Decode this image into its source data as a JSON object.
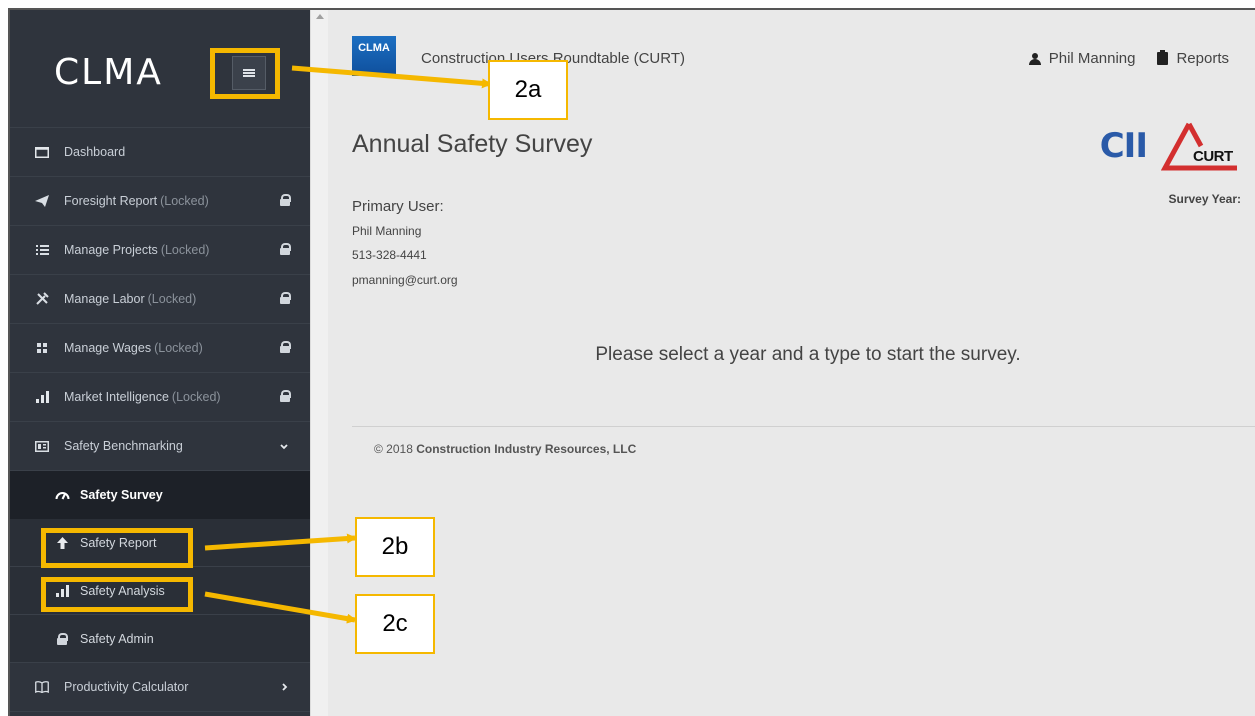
{
  "sidebar": {
    "logo": "CLMA",
    "items": [
      {
        "label": "Dashboard",
        "suffix": "",
        "icon": "monitor-icon"
      },
      {
        "label": "Foresight Report",
        "suffix": "(Locked)",
        "icon": "paper-plane-icon"
      },
      {
        "label": "Manage Projects",
        "suffix": "(Locked)",
        "icon": "list-icon"
      },
      {
        "label": "Manage Labor",
        "suffix": "(Locked)",
        "icon": "tools-icon"
      },
      {
        "label": "Manage Wages",
        "suffix": "(Locked)",
        "icon": "grid-icon"
      },
      {
        "label": "Market Intelligence",
        "suffix": "(Locked)",
        "icon": "bar-chart-icon"
      },
      {
        "label": "Safety Benchmarking",
        "suffix": "",
        "icon": "newspaper-icon"
      }
    ],
    "subitems": [
      {
        "label": "Safety Survey",
        "icon": "gauge-icon",
        "active": true
      },
      {
        "label": "Safety Report",
        "icon": "arrow-up-icon"
      },
      {
        "label": "Safety Analysis",
        "icon": "bar-chart-icon"
      },
      {
        "label": "Safety Admin",
        "icon": "lock-icon"
      }
    ],
    "last_item": {
      "label": "Productivity Calculator",
      "icon": "book-icon"
    }
  },
  "header": {
    "org_logo": "CLMA",
    "org_name": "Construction Users Roundtable (CURT)",
    "user_name": "Phil Manning",
    "reports_label": "Reports"
  },
  "main": {
    "title": "Annual Safety Survey",
    "primary_user_label": "Primary User:",
    "primary_user_name": "Phil Manning",
    "primary_user_phone": "513-328-4441",
    "primary_user_email": "pmanning@curt.org",
    "survey_year_label": "Survey Year:",
    "prompt": "Please select a year and a type to start the survey.",
    "footer_prefix": "© 2018",
    "footer_company": "Construction Industry Resources, LLC",
    "cii_logo": "CII",
    "curt_logo": "CURT"
  },
  "callouts": {
    "a": "2a",
    "b": "2b",
    "c": "2c"
  },
  "colors": {
    "sidebar_bg": "#2f343d",
    "main_bg": "#e9e9e9",
    "callout_accent": "#f5b800",
    "curt_red": "#d32f2f",
    "cii_blue": "#2a5aa8"
  }
}
